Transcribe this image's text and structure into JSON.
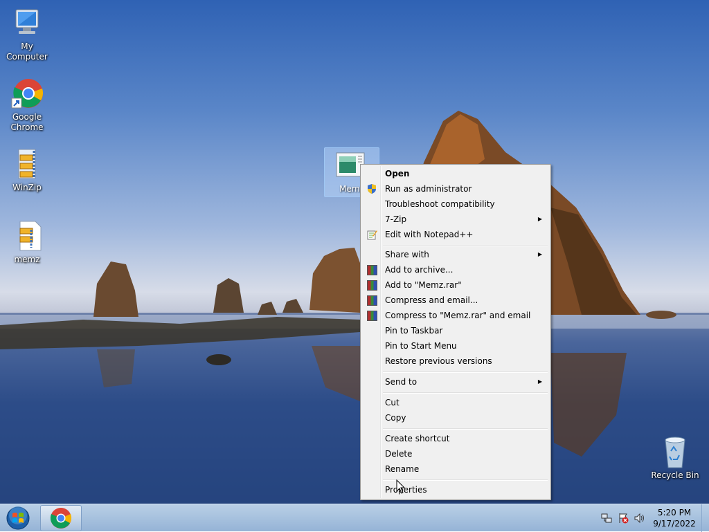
{
  "desktop_icons": [
    {
      "label": "My Computer",
      "icon": "computer-icon"
    },
    {
      "label": "Google Chrome",
      "icon": "chrome-icon"
    },
    {
      "label": "WinZip",
      "icon": "winzip-icon"
    },
    {
      "label": "memz",
      "icon": "zip-file-icon"
    },
    {
      "label": "Recycle Bin",
      "icon": "recycle-bin-icon"
    }
  ],
  "selected_icon": {
    "label": "Memz",
    "icon": "executable-icon"
  },
  "context_menu": {
    "items": [
      {
        "label": "Open",
        "bold": true
      },
      {
        "label": "Run as administrator",
        "icon": "uac-shield-icon"
      },
      {
        "label": "Troubleshoot compatibility"
      },
      {
        "label": "7-Zip",
        "submenu": true
      },
      {
        "label": "Edit with Notepad++",
        "icon": "notepadpp-icon"
      },
      {
        "label": "Share with",
        "submenu": true
      },
      {
        "label": "Add to archive...",
        "icon": "winrar-icon"
      },
      {
        "label": "Add to \"Memz.rar\"",
        "icon": "winrar-icon"
      },
      {
        "label": "Compress and email...",
        "icon": "winrar-icon"
      },
      {
        "label": "Compress to \"Memz.rar\" and email",
        "icon": "winrar-icon"
      },
      {
        "label": "Pin to Taskbar"
      },
      {
        "label": "Pin to Start Menu"
      },
      {
        "label": "Restore previous versions"
      },
      {
        "label": "Send to",
        "submenu": true
      },
      {
        "label": "Cut"
      },
      {
        "label": "Copy"
      },
      {
        "label": "Create shortcut"
      },
      {
        "label": "Delete"
      },
      {
        "label": "Rename"
      },
      {
        "label": "Properties"
      }
    ],
    "submenu_arrow": "▶"
  },
  "taskbar": {
    "pinned": [
      {
        "name": "Google Chrome",
        "icon": "chrome-icon"
      }
    ],
    "tray_icons": [
      "network-icon",
      "action-center-flag-icon",
      "volume-icon"
    ],
    "clock": {
      "time": "5:20 PM",
      "date": "9/17/2022"
    }
  }
}
